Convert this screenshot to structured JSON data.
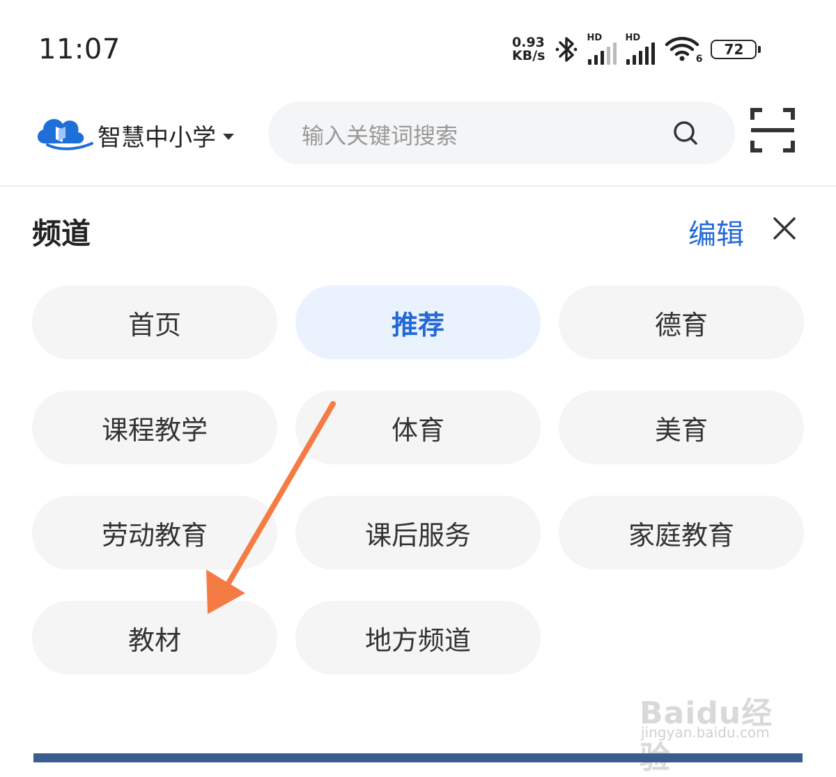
{
  "status_bar": {
    "time": "11:07",
    "net_speed_value": "0.93",
    "net_speed_unit": "KB/s",
    "hd_label": "HD",
    "wifi_label": "6",
    "battery": "72",
    "icons": [
      "bluetooth-icon",
      "signal-icon",
      "signal-icon",
      "wifi-icon",
      "battery-icon"
    ]
  },
  "header": {
    "app_name": "智慧中小学",
    "search_placeholder": "输入关键词搜索",
    "brand_color": "#2369d6"
  },
  "panel": {
    "title": "频道",
    "edit_label": "编辑",
    "channels": [
      {
        "label": "首页",
        "active": false
      },
      {
        "label": "推荐",
        "active": true
      },
      {
        "label": "德育",
        "active": false
      },
      {
        "label": "课程教学",
        "active": false
      },
      {
        "label": "体育",
        "active": false
      },
      {
        "label": "美育",
        "active": false
      },
      {
        "label": "劳动教育",
        "active": false
      },
      {
        "label": "课后服务",
        "active": false
      },
      {
        "label": "家庭教育",
        "active": false
      },
      {
        "label": "教材",
        "active": false
      },
      {
        "label": "地方频道",
        "active": false
      }
    ]
  },
  "annotation": {
    "arrow_color": "#f47c44",
    "points_to": "教材"
  },
  "watermark": {
    "logo": "Baidu经验",
    "url": "jingyan.baidu.com"
  }
}
